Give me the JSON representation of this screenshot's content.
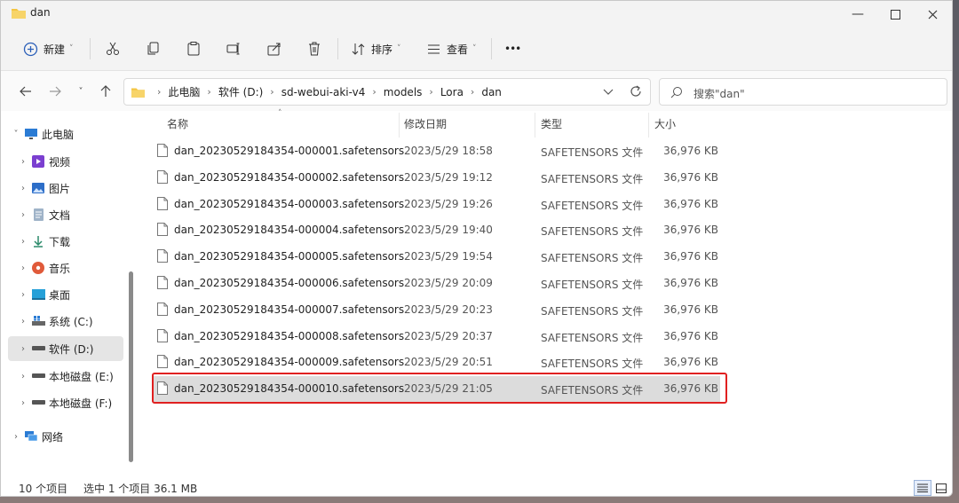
{
  "window": {
    "title": "dan"
  },
  "toolbar": {
    "new_label": "新建",
    "sort_label": "排序",
    "view_label": "查看",
    "more_label": "•••"
  },
  "address": {
    "crumbs": [
      "此电脑",
      "软件 (D:)",
      "sd-webui-aki-v4",
      "models",
      "Lora",
      "dan"
    ],
    "search_placeholder": "搜索\"dan\""
  },
  "sidebar": {
    "items": [
      {
        "label": "此电脑",
        "icon": "pc-icon",
        "expanded": true
      },
      {
        "label": "视频",
        "icon": "video-icon"
      },
      {
        "label": "图片",
        "icon": "pictures-icon"
      },
      {
        "label": "文档",
        "icon": "documents-icon"
      },
      {
        "label": "下载",
        "icon": "download-icon"
      },
      {
        "label": "音乐",
        "icon": "music-icon"
      },
      {
        "label": "桌面",
        "icon": "desktop-icon"
      },
      {
        "label": "系统 (C:)",
        "icon": "windows-drive-icon"
      },
      {
        "label": "软件 (D:)",
        "icon": "drive-icon",
        "selected": true
      },
      {
        "label": "本地磁盘 (E:)",
        "icon": "drive-icon"
      },
      {
        "label": "本地磁盘 (F:)",
        "icon": "drive-icon"
      },
      {
        "label": "网络",
        "icon": "network-icon"
      }
    ]
  },
  "columns": {
    "name": "名称",
    "date": "修改日期",
    "type": "类型",
    "size": "大小"
  },
  "files": [
    {
      "name": "dan_20230529184354-000001.safetensors",
      "date": "2023/5/29 18:58",
      "type": "SAFETENSORS 文件",
      "size": "36,976 KB"
    },
    {
      "name": "dan_20230529184354-000002.safetensors",
      "date": "2023/5/29 19:12",
      "type": "SAFETENSORS 文件",
      "size": "36,976 KB"
    },
    {
      "name": "dan_20230529184354-000003.safetensors",
      "date": "2023/5/29 19:26",
      "type": "SAFETENSORS 文件",
      "size": "36,976 KB"
    },
    {
      "name": "dan_20230529184354-000004.safetensors",
      "date": "2023/5/29 19:40",
      "type": "SAFETENSORS 文件",
      "size": "36,976 KB"
    },
    {
      "name": "dan_20230529184354-000005.safetensors",
      "date": "2023/5/29 19:54",
      "type": "SAFETENSORS 文件",
      "size": "36,976 KB"
    },
    {
      "name": "dan_20230529184354-000006.safetensors",
      "date": "2023/5/29 20:09",
      "type": "SAFETENSORS 文件",
      "size": "36,976 KB"
    },
    {
      "name": "dan_20230529184354-000007.safetensors",
      "date": "2023/5/29 20:23",
      "type": "SAFETENSORS 文件",
      "size": "36,976 KB"
    },
    {
      "name": "dan_20230529184354-000008.safetensors",
      "date": "2023/5/29 20:37",
      "type": "SAFETENSORS 文件",
      "size": "36,976 KB"
    },
    {
      "name": "dan_20230529184354-000009.safetensors",
      "date": "2023/5/29 20:51",
      "type": "SAFETENSORS 文件",
      "size": "36,976 KB"
    },
    {
      "name": "dan_20230529184354-000010.safetensors",
      "date": "2023/5/29 21:05",
      "type": "SAFETENSORS 文件",
      "size": "36,976 KB",
      "selected": true
    }
  ],
  "status": {
    "item_count": "10 个项目",
    "selection": "选中 1 个项目  36.1 MB"
  },
  "colors": {
    "highlight_border": "#e02020",
    "selection_bg": "#dcdcdc"
  }
}
